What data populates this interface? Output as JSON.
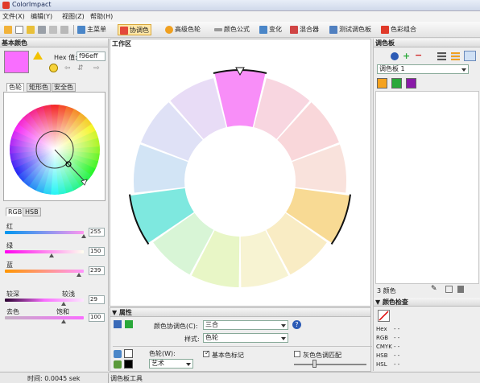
{
  "title": "ColorImpact",
  "menu": [
    "文件(X)",
    "编辑(Y)",
    "视图(Z)",
    "帮助(H)"
  ],
  "toolbar": {
    "items": [
      {
        "label": "主菜单",
        "color": "#4a86c8"
      },
      {
        "label": "协调色",
        "color": "#e3483a",
        "active": true
      },
      {
        "label": "高级色轮",
        "color": "#f0a020"
      },
      {
        "label": "颜色公式",
        "color": "#999999"
      },
      {
        "label": "变化",
        "color": "#4a86c8"
      },
      {
        "label": "混合器",
        "color": "#d04545"
      },
      {
        "label": "测试调色板",
        "color": "#5080c0"
      },
      {
        "label": "色彩组合",
        "color": "#e03a2a"
      }
    ]
  },
  "left": {
    "title": "基本颜色",
    "hex_label": "Hex 值:",
    "hex_value": "f96eff",
    "current_color": "#f96eff",
    "tabs": [
      "色轮",
      "矩形色",
      "安全色"
    ],
    "model_tabs": [
      "RGB",
      "HSB"
    ],
    "rgb": [
      {
        "label": "红",
        "value": "255",
        "frac": 1.0
      },
      {
        "label": "绿",
        "value": "150",
        "frac": 0.59
      },
      {
        "label": "蓝",
        "value": "239",
        "frac": 0.94
      }
    ],
    "shade": {
      "left": "较深",
      "right": "较浅",
      "value": "29",
      "frac": 0.74
    },
    "sat": {
      "left": "去色",
      "right": "饱和",
      "value": "100",
      "frac": 0.74
    }
  },
  "workspace": {
    "title": "工作区"
  },
  "wheel": {
    "segments": [
      "#f88ef8",
      "#f8d6e0",
      "#f9d7da",
      "#f9e2dc",
      "#f8da94",
      "#f9ecc4",
      "#f7f3d2",
      "#e8f6c6",
      "#d8f5d6",
      "#7ee8df",
      "#d2e4f5",
      "#dfe1f6",
      "#e8dcf6"
    ],
    "highlight": [
      0,
      4,
      9
    ]
  },
  "props": {
    "title": "属性",
    "harmony_label": "颜色协调色(C):",
    "harmony_value": "三合",
    "style_label": "样式:",
    "style_value": "色轮",
    "wheel_label": "色轮(W):",
    "wheel_value": "艺术",
    "basic_mark": "基本色标记",
    "gray_match": "灰色色调匹配"
  },
  "right": {
    "title": "调色板",
    "palette_name": "调色板 1",
    "swatches": [
      "#f5a21e",
      "#2aa83a",
      "#8a1aa8"
    ],
    "count": "3 颜色",
    "inspect_title": "颜色检查",
    "info": [
      {
        "k": "Hex",
        "v": "- -"
      },
      {
        "k": "RGB",
        "v": "- -"
      },
      {
        "k": "CMYK",
        "v": "- -"
      },
      {
        "k": "HSB",
        "v": "- -"
      },
      {
        "k": "HSL",
        "v": "- -"
      }
    ]
  },
  "status": {
    "time": "时间: 0.0045 sek",
    "tool": "调色板工具"
  }
}
